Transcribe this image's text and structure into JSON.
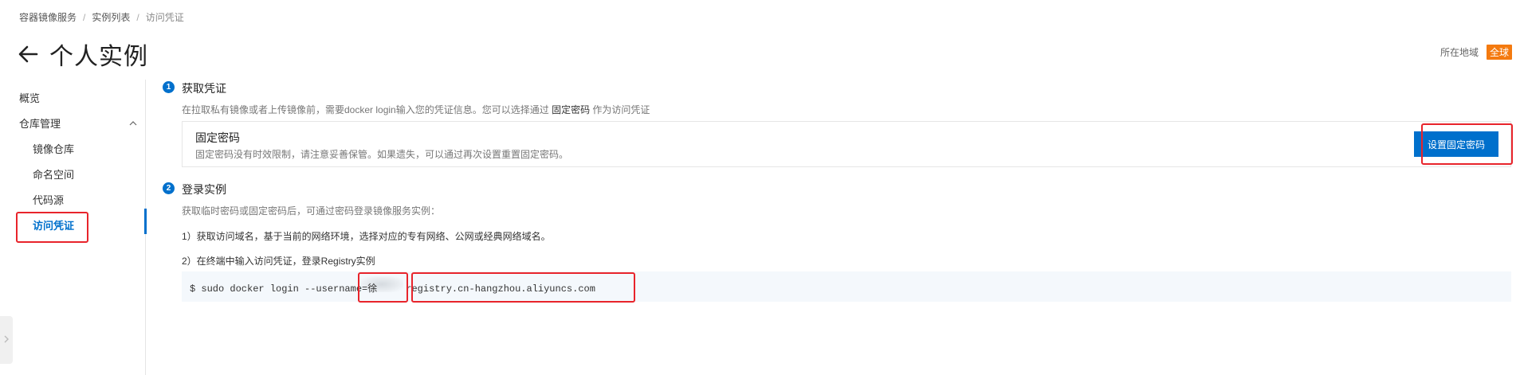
{
  "breadcrumb": {
    "items": [
      "容器镜像服务",
      "实例列表",
      "访问凭证"
    ],
    "separator": "/"
  },
  "page": {
    "title": "个人实例"
  },
  "region": {
    "label": "所在地域",
    "value": "全球"
  },
  "sidebar": {
    "items": [
      {
        "label": "概览"
      },
      {
        "label": "仓库管理"
      },
      {
        "label": "镜像仓库"
      },
      {
        "label": "命名空间"
      },
      {
        "label": "代码源"
      },
      {
        "label": "访问凭证"
      }
    ]
  },
  "step1": {
    "number": "1",
    "title": "获取凭证",
    "desc_prefix": "在拉取私有镜像或者上传镜像前，需要docker login输入您的凭证信息。您可以选择通过",
    "desc_highlight": "固定密码",
    "desc_suffix": "作为访问凭证",
    "card": {
      "title": "固定密码",
      "desc": "固定密码没有时效限制，请注意妥善保管。如果遗失，可以通过再次设置重置固定密码。",
      "button_label": "设置固定密码"
    }
  },
  "step2": {
    "number": "2",
    "title": "登录实例",
    "desc": "获取临时密码或固定密码后，可通过密码登录镜像服务实例：",
    "line1": "1）获取访问域名，基于当前的网络环境，选择对应的专有网络、公网或经典网络域名。",
    "line2": "2）在终端中输入访问凭证，登录Registry实例",
    "code_prefix": "$ sudo docker login --username=",
    "code_user": "徐",
    "code_registry": "registry.cn-hangzhou.aliyuncs.com"
  },
  "colors": {
    "accent": "#0070cc",
    "badge": "#f47a0f",
    "highlight_box": "#e8242b"
  }
}
